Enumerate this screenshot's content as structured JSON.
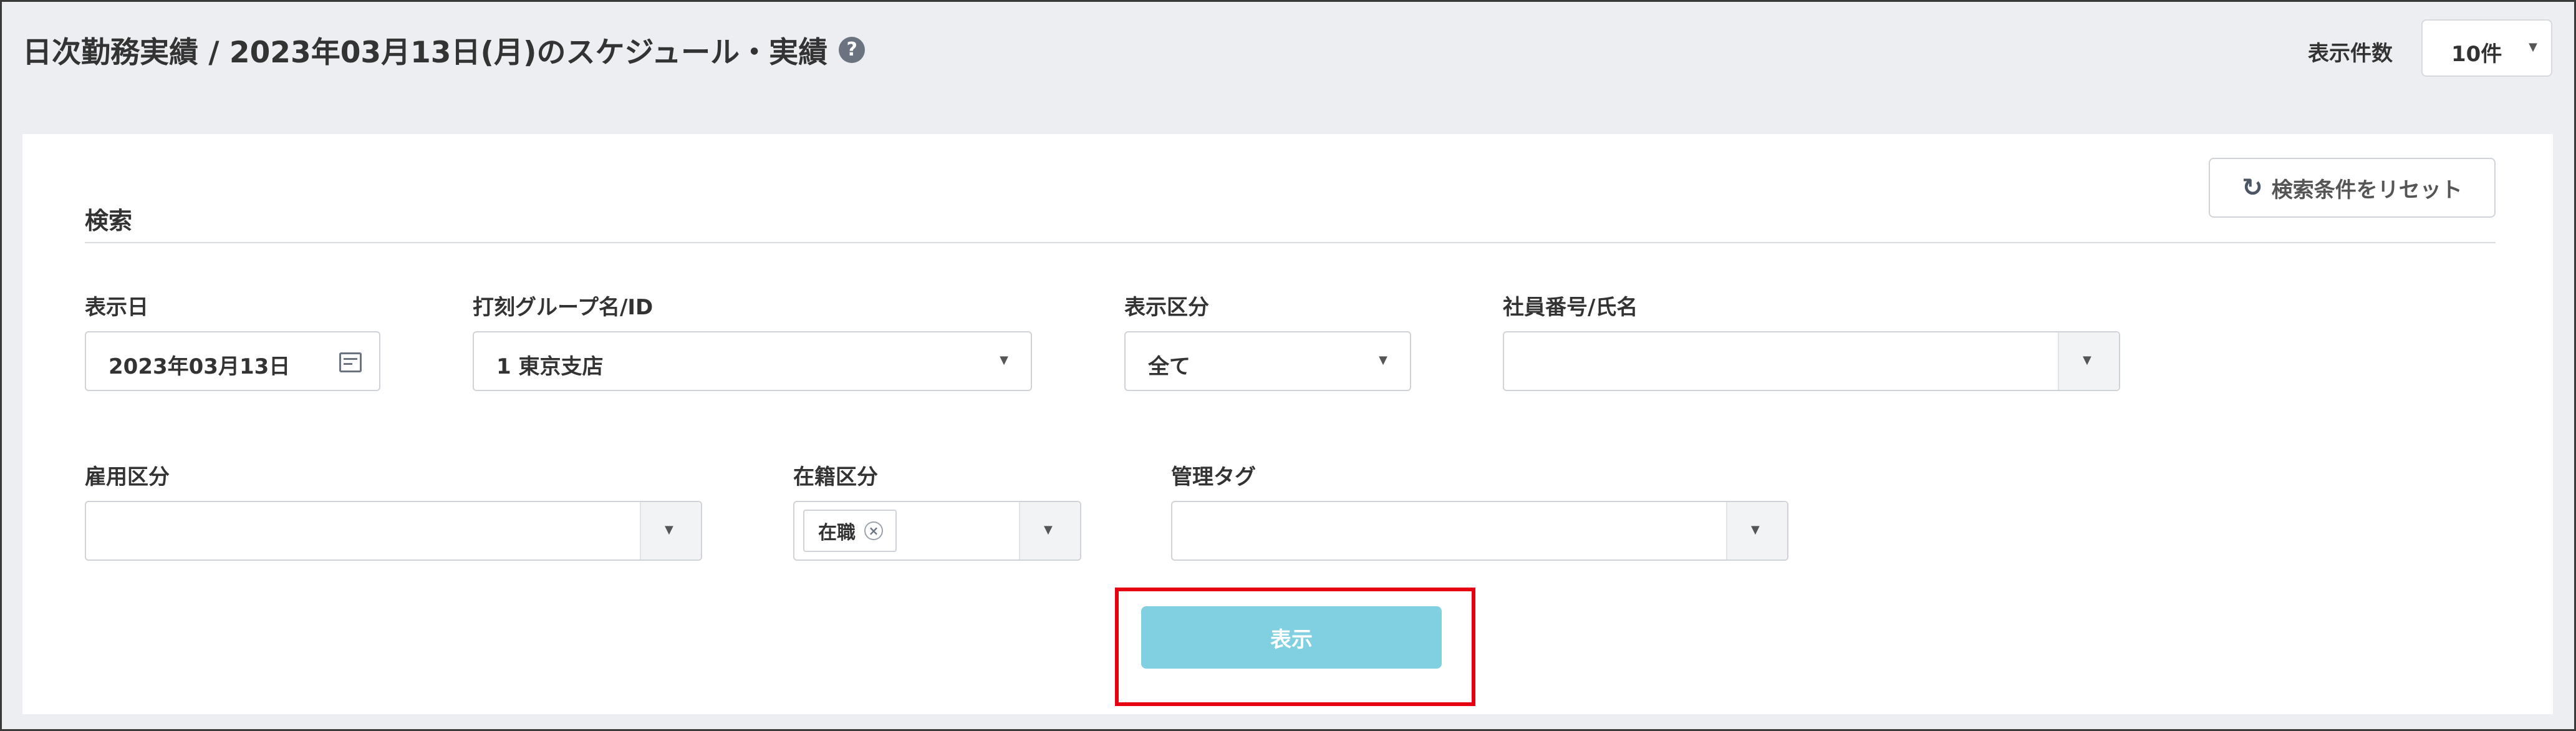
{
  "header": {
    "title": "日次勤務実績 / 2023年03月13日(月)のスケジュール・実績",
    "help_icon": "help-icon",
    "per_page_label": "表示件数",
    "per_page_value": "10件"
  },
  "search": {
    "section_title": "検索",
    "reset_label": "検索条件をリセット",
    "reset_icon": "refresh-icon",
    "fields": {
      "display_date": {
        "label": "表示日",
        "value": "2023年03月13日",
        "icon": "calendar-icon"
      },
      "clock_group": {
        "label": "打刻グループ名/ID",
        "value": "1 東京支店"
      },
      "display_category": {
        "label": "表示区分",
        "value": "全て"
      },
      "employee": {
        "label": "社員番号/氏名",
        "value": ""
      },
      "employment_type": {
        "label": "雇用区分",
        "value": ""
      },
      "enrollment_status": {
        "label": "在籍区分",
        "tags": [
          "在職"
        ]
      },
      "management_tag": {
        "label": "管理タグ",
        "value": ""
      }
    },
    "submit_label": "表示"
  },
  "colors": {
    "submit_button": "#81d0e1",
    "highlight_border": "#e60012",
    "header_background": "#eceef1"
  }
}
